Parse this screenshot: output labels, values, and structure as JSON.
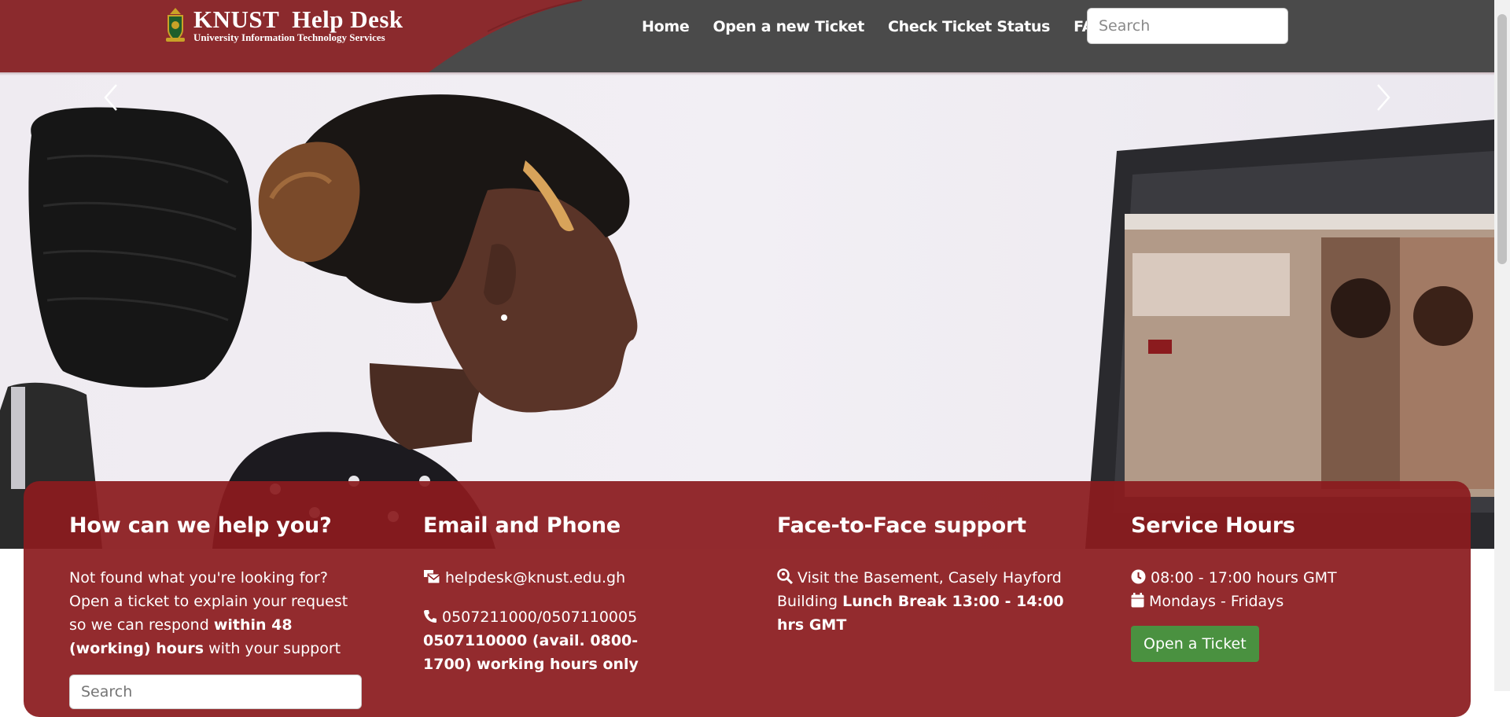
{
  "header": {
    "brand_title": "KNUST  Help Desk",
    "brand_subtitle": "University Information Technology Services",
    "nav": [
      {
        "label": "Home"
      },
      {
        "label": "Open a new Ticket"
      },
      {
        "label": "Check Ticket Status"
      },
      {
        "label": "FAQs"
      }
    ],
    "search_placeholder": "Search"
  },
  "colors": {
    "brand_red": "#8b1b1e",
    "header_gray": "#4a4a4a",
    "button_green": "#4a9140"
  },
  "carousel": {
    "prev_icon": "chevron-left-icon",
    "next_icon": "chevron-right-icon"
  },
  "help": {
    "title": "How can we help you?",
    "text_1": "Not found what you're looking for? Open a ticket to explain your request so we can respond ",
    "text_bold": "within 48 (working) hours",
    "text_2": " with your support",
    "search_placeholder": "Search"
  },
  "contact": {
    "title": "Email and Phone",
    "email": "helpdesk@knust.edu.gh",
    "phone": "0507211000/0507110005",
    "phone_note": "0507110000 (avail. 0800-1700) working hours only"
  },
  "face_to_face": {
    "title": "Face-to-Face support",
    "text": "Visit the Basement, Casely Hayford Building ",
    "text_bold": "Lunch Break 13:00 - 14:00 hrs GMT"
  },
  "service_hours": {
    "title": "Service Hours",
    "hours": "08:00 - 17:00 hours GMT",
    "days": "Mondays - Fridays",
    "button_label": "Open a Ticket"
  }
}
